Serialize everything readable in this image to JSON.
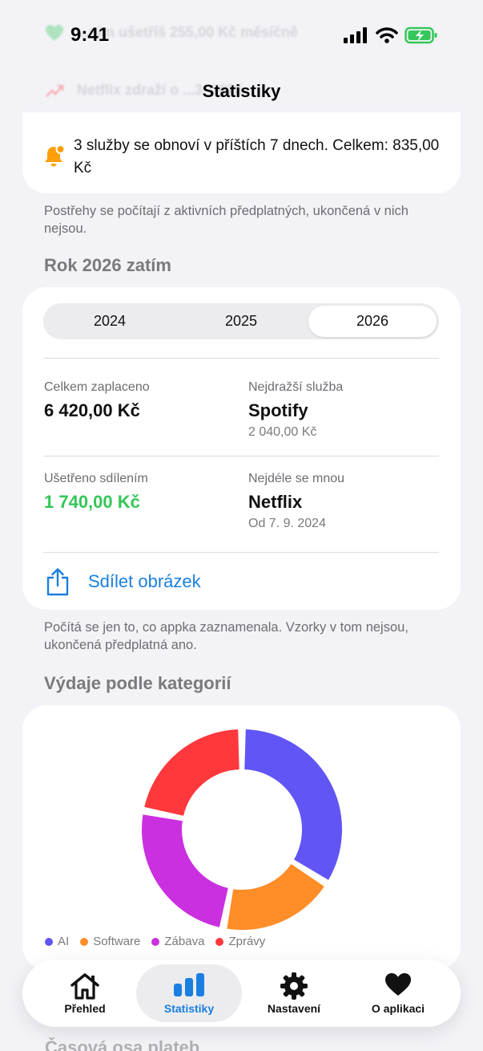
{
  "status_bar": {
    "time": "9:41"
  },
  "background_rows": [
    {
      "text": "...ním ušetříš 255,00 Kč měsíčně",
      "icon": "heart-icon"
    },
    {
      "text": "Netflix zdraží o ...3. 2025",
      "icon": "trend-up-icon"
    }
  ],
  "nav": {
    "title": "Statistiky"
  },
  "insights": {
    "alert_icon": "bell-badge-icon",
    "alert_text": "3 služby se obnoví v příštích 7 dnech. Celkem: 835,00 Kč",
    "footnote": "Postřehy se počítají z aktivních předplatných, ukončená v nich nejsou."
  },
  "year_section": {
    "title": "Rok 2026 zatím",
    "years": [
      "2024",
      "2025",
      "2026"
    ],
    "selected_year": "2026",
    "total_paid_label": "Celkem zaplaceno",
    "total_paid_value": "6 420,00 Kč",
    "most_expensive_label": "Nejdražší služba",
    "most_expensive_value": "Spotify",
    "most_expensive_sub": "2 040,00 Kč",
    "saved_label": "Ušetřeno sdílením",
    "saved_value": "1 740,00 Kč",
    "saved_color": "#34c759",
    "longest_label": "Nejdéle se mnou",
    "longest_value": "Netflix",
    "longest_sub": "Od 7. 9. 2024",
    "share_label": "Sdílet obrázek",
    "share_icon": "share-icon",
    "footnote": "Počítá se jen to, co appka zaznamenala. Vzorky v tom nejsou, ukončená předplatná ano."
  },
  "categories_section": {
    "title": "Výdaje podle kategorií"
  },
  "chart_data": {
    "type": "pie",
    "categories": [
      "AI",
      "Software",
      "Zábava",
      "Zprávy"
    ],
    "values": [
      34,
      19,
      25,
      22
    ],
    "colors": [
      "#6155f5",
      "#ff8d28",
      "#cb30e0",
      "#ff383c"
    ],
    "donut": true,
    "legend_position": "bottom-left"
  },
  "tabbar": {
    "tabs": [
      {
        "label": "Přehled",
        "icon": "house-icon"
      },
      {
        "label": "Statistiky",
        "icon": "bar-chart-icon"
      },
      {
        "label": "Nastavení",
        "icon": "gear-icon"
      },
      {
        "label": "O aplikaci",
        "icon": "heart-icon"
      }
    ],
    "active": "Statistiky",
    "accent": "#1a7fe0"
  },
  "below_fold_title": "Časová osa plateb"
}
